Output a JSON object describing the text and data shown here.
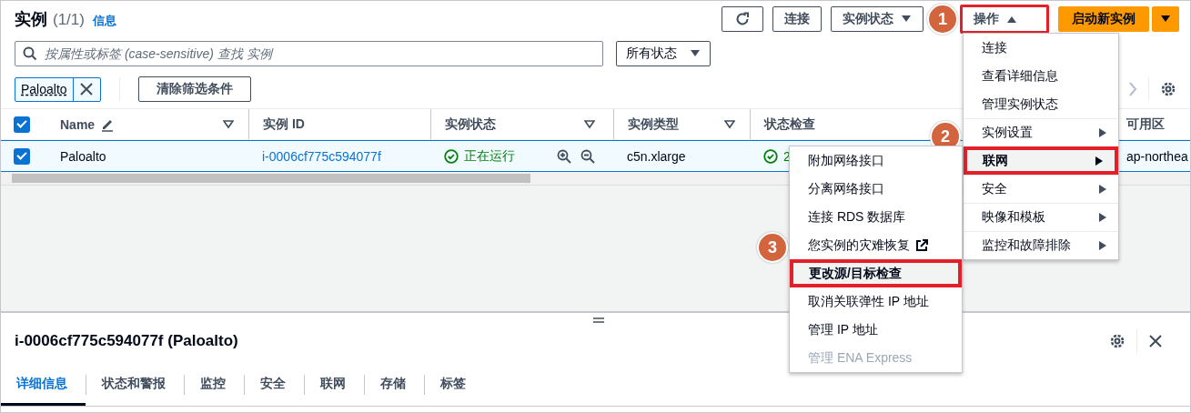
{
  "header": {
    "title": "实例",
    "count": "(1/1)",
    "info_link": "信息"
  },
  "buttons": [
    {
      "kind": "refresh"
    },
    {
      "kind": "plain",
      "label": "连接"
    },
    {
      "kind": "dropdown",
      "label": "实例状态",
      "expanded": false
    },
    {
      "kind": "dropdown",
      "label": "操作",
      "expanded": true,
      "callout": "1"
    },
    {
      "kind": "primary",
      "label": "启动新实例"
    },
    {
      "kind": "primary-caret"
    }
  ],
  "search": {
    "placeholder": "按属性或标签 (case-sensitive) 查找 实例"
  },
  "state_filter": {
    "value": "所有状态"
  },
  "filter_tokens": [
    {
      "label": "Paloalto"
    }
  ],
  "clear_filters": "清除筛选条件",
  "table": {
    "all_selected": true,
    "columns": [
      {
        "label": "Name",
        "editable": true,
        "filterable": true
      },
      {
        "label": "实例 ID",
        "filterable": false
      },
      {
        "label": "实例状态",
        "filterable": true
      },
      {
        "label": "实例类型",
        "filterable": true
      },
      {
        "label": "状态检查"
      },
      {
        "label": "可用区",
        "filterable": false
      }
    ],
    "rows": [
      {
        "selected": true,
        "name": "Paloalto",
        "instance_id": "i-0006cf775c594077f",
        "state": "正在运行",
        "type": "c5n.xlarge",
        "status_check": "2",
        "zone": "ap-northea"
      }
    ]
  },
  "actions_menu": {
    "items": [
      {
        "label": "连接",
        "kind": "action"
      },
      {
        "label": "查看详细信息",
        "kind": "action"
      },
      {
        "label": "管理实例状态",
        "kind": "action"
      },
      {
        "label": "实例设置",
        "kind": "submenu",
        "selected": false
      },
      {
        "label": "联网",
        "kind": "submenu",
        "selected": true,
        "callout": "2"
      },
      {
        "label": "安全",
        "kind": "submenu",
        "selected": false
      },
      {
        "label": "映像和模板",
        "kind": "submenu",
        "selected": false
      },
      {
        "label": "监控和故障排除",
        "kind": "submenu",
        "selected": false
      }
    ]
  },
  "networking_menu": {
    "items": [
      {
        "label": "附加网络接口",
        "selected": false,
        "disabled": false
      },
      {
        "label": "分离网络接口",
        "selected": false,
        "disabled": false
      },
      {
        "label": "连接 RDS 数据库",
        "selected": false,
        "disabled": false
      },
      {
        "label": "您实例的灾难恢复",
        "selected": false,
        "disabled": false,
        "external": true
      },
      {
        "label": "更改源/目标检查",
        "selected": true,
        "disabled": false,
        "callout": "3"
      },
      {
        "label": "取消关联弹性 IP 地址",
        "selected": false,
        "disabled": false
      },
      {
        "label": "管理 IP 地址",
        "selected": false,
        "disabled": false
      },
      {
        "label": "管理 ENA Express",
        "selected": false,
        "disabled": true
      }
    ]
  },
  "details": {
    "title": "i-0006cf775c594077f (Paloalto)",
    "tabs": [
      {
        "label": "详细信息",
        "selected": true
      },
      {
        "label": "状态和警报",
        "selected": false
      },
      {
        "label": "监控",
        "selected": false
      },
      {
        "label": "安全",
        "selected": false
      },
      {
        "label": "联网",
        "selected": false
      },
      {
        "label": "存储",
        "selected": false
      },
      {
        "label": "标签",
        "selected": false
      }
    ]
  }
}
